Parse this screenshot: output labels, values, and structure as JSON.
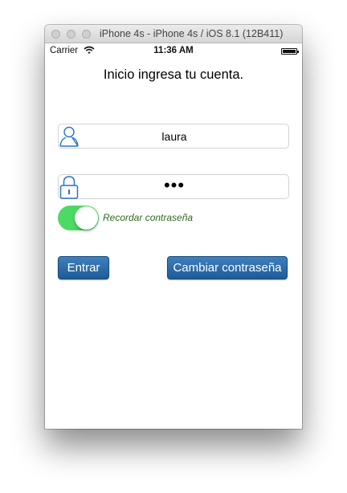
{
  "window": {
    "title": "iPhone 4s - iPhone 4s / iOS 8.1 (12B411)"
  },
  "statusbar": {
    "carrier": "Carrier",
    "time": "11:36 AM"
  },
  "login": {
    "heading": "Inicio ingresa tu cuenta.",
    "username_value": "laura",
    "password_value": "•••",
    "remember_label": "Recordar contraseña",
    "remember_on": true,
    "enter_label": "Entrar",
    "change_password_label": "Cambiar contraseña"
  },
  "colors": {
    "toggle_on": "#4cd964",
    "button_blue": "#2a6aa8",
    "icon_blue": "#2a73c8",
    "label_green": "#2c6a1f"
  },
  "icons": {
    "user": "user-icon",
    "lock": "lock-icon",
    "wifi": "wifi-icon",
    "battery": "battery-icon"
  }
}
